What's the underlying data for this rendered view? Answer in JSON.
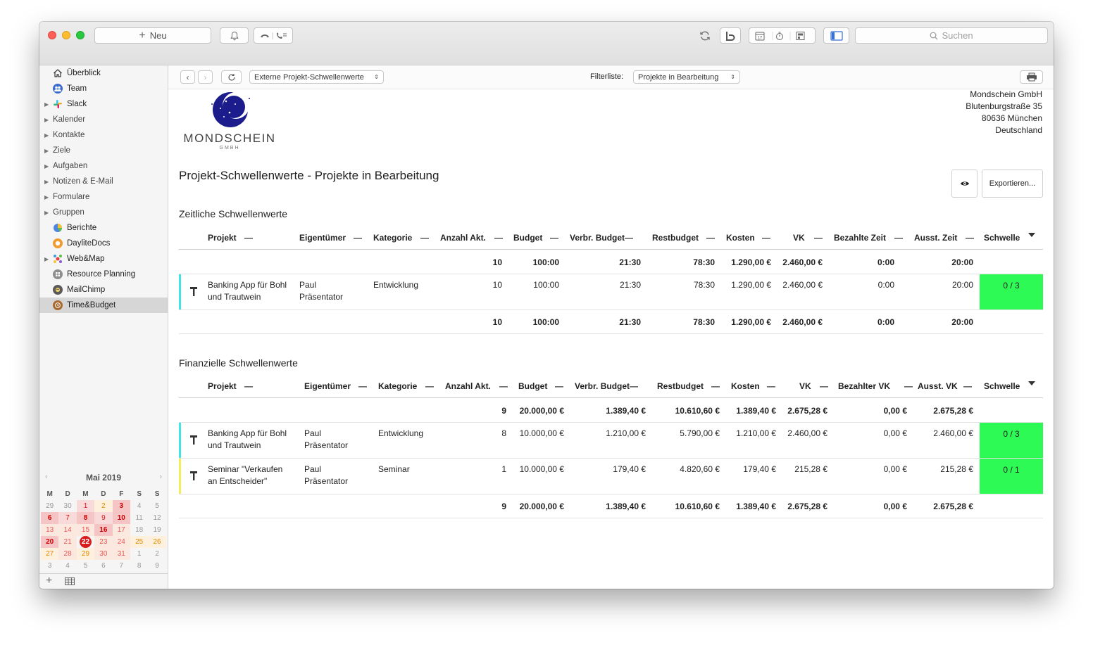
{
  "toolbar": {
    "new_label": "Neu",
    "search_placeholder": "Suchen"
  },
  "sidebar": {
    "items": [
      {
        "label": "Überblick",
        "icon": "house-icon"
      },
      {
        "label": "Team",
        "icon": "team-icon"
      },
      {
        "label": "Slack",
        "icon": "slack-icon"
      },
      {
        "label": "Kalender"
      },
      {
        "label": "Kontakte"
      },
      {
        "label": "Ziele"
      },
      {
        "label": "Aufgaben"
      },
      {
        "label": "Notizen & E-Mail"
      },
      {
        "label": "Formulare"
      },
      {
        "label": "Gruppen"
      },
      {
        "label": "Berichte",
        "icon": "pie-chart-icon"
      },
      {
        "label": "DayliteDocs",
        "icon": "documents-icon"
      },
      {
        "label": "Web&Map",
        "icon": "web-map-icon"
      },
      {
        "label": "Resource Planning",
        "icon": "resource-planning-icon"
      },
      {
        "label": "MailChimp",
        "icon": "mailchimp-icon"
      },
      {
        "label": "Time&Budget",
        "icon": "time-budget-icon"
      }
    ],
    "calendar": {
      "month": "Mai 2019",
      "weekdays": [
        "M",
        "D",
        "M",
        "D",
        "F",
        "S",
        "S"
      ],
      "weeks": [
        [
          "29",
          "30",
          "1",
          "2",
          "3",
          "4",
          "5"
        ],
        [
          "6",
          "7",
          "8",
          "9",
          "10",
          "11",
          "12"
        ],
        [
          "13",
          "14",
          "15",
          "16",
          "17",
          "18",
          "19"
        ],
        [
          "20",
          "21",
          "22",
          "23",
          "24",
          "25",
          "26"
        ],
        [
          "27",
          "28",
          "29",
          "30",
          "31",
          "1",
          "2"
        ],
        [
          "3",
          "4",
          "5",
          "6",
          "7",
          "8",
          "9"
        ]
      ]
    }
  },
  "content_toolbar": {
    "report_select": "Externe Projekt-Schwellenwerte",
    "filter_label": "Filterliste:",
    "filter_select": "Projekte in Bearbeitung"
  },
  "company": {
    "name": "Mondschein GmbH",
    "street": "Blutenburgstraße 35",
    "city": "80636 München",
    "country": "Deutschland",
    "logo_text": "MONDSCHEIN",
    "logo_sub": "GMBH"
  },
  "page": {
    "title": "Projekt-Schwellenwerte - Projekte in Bearbeitung",
    "export_label": "Exportieren..."
  },
  "time_table": {
    "title": "Zeitliche Schwellenwerte",
    "headers": [
      "Projekt",
      "Eigentümer",
      "Kategorie",
      "Anzahl Akt.",
      "Budget",
      "Verbr. Budget",
      "Restbudget",
      "Kosten",
      "VK",
      "Bezahlte Zeit",
      "Ausst. Zeit",
      "Schwelle"
    ],
    "total_top": [
      "10",
      "100:00",
      "21:30",
      "78:30",
      "1.290,00 €",
      "2.460,00 €",
      "0:00",
      "20:00"
    ],
    "rows": [
      {
        "project_l1": "Banking App für Bohl",
        "project_l2": "und Trautwein",
        "owner_l1": "Paul",
        "owner_l2": "Präsentator",
        "category": "Entwicklung",
        "values": [
          "10",
          "100:00",
          "21:30",
          "78:30",
          "1.290,00 €",
          "2.460,00 €",
          "0:00",
          "20:00"
        ],
        "threshold": "0 / 3",
        "bar_color": "#3ee6e6"
      }
    ],
    "total_bottom": [
      "10",
      "100:00",
      "21:30",
      "78:30",
      "1.290,00 €",
      "2.460,00 €",
      "0:00",
      "20:00"
    ]
  },
  "fin_table": {
    "title": "Finanzielle Schwellenwerte",
    "headers": [
      "Projekt",
      "Eigentümer",
      "Kategorie",
      "Anzahl Akt.",
      "Budget",
      "Verbr. Budget",
      "Restbudget",
      "Kosten",
      "VK",
      "Bezahlter VK",
      "Ausst. VK",
      "Schwelle"
    ],
    "total_top": [
      "9",
      "20.000,00 €",
      "1.389,40 €",
      "10.610,60 €",
      "1.389,40 €",
      "2.675,28 €",
      "0,00 €",
      "2.675,28 €"
    ],
    "rows": [
      {
        "project_l1": "Banking App für Bohl",
        "project_l2": "und Trautwein",
        "owner_l1": "Paul",
        "owner_l2": "Präsentator",
        "category": "Entwicklung",
        "values": [
          "8",
          "10.000,00 €",
          "1.210,00 €",
          "5.790,00 €",
          "1.210,00 €",
          "2.460,00 €",
          "0,00 €",
          "2.460,00 €"
        ],
        "threshold": "0 / 3",
        "bar_color": "#3ee6e6"
      },
      {
        "project_l1": "Seminar \"Verkaufen",
        "project_l2": "an Entscheider\"",
        "owner_l1": "Paul",
        "owner_l2": "Präsentator",
        "category": "Seminar",
        "values": [
          "1",
          "10.000,00 €",
          "179,40 €",
          "4.820,60 €",
          "179,40 €",
          "215,28 €",
          "0,00 €",
          "215,28 €"
        ],
        "threshold": "0 / 1",
        "bar_color": "#f5ec5a"
      }
    ],
    "total_bottom": [
      "9",
      "20.000,00 €",
      "1.389,40 €",
      "10.610,60 €",
      "1.389,40 €",
      "2.675,28 €",
      "0,00 €",
      "2.675,28 €"
    ]
  },
  "colors": {
    "threshold_ok": "#2dfa55",
    "accent_red": "#d91c1c"
  }
}
